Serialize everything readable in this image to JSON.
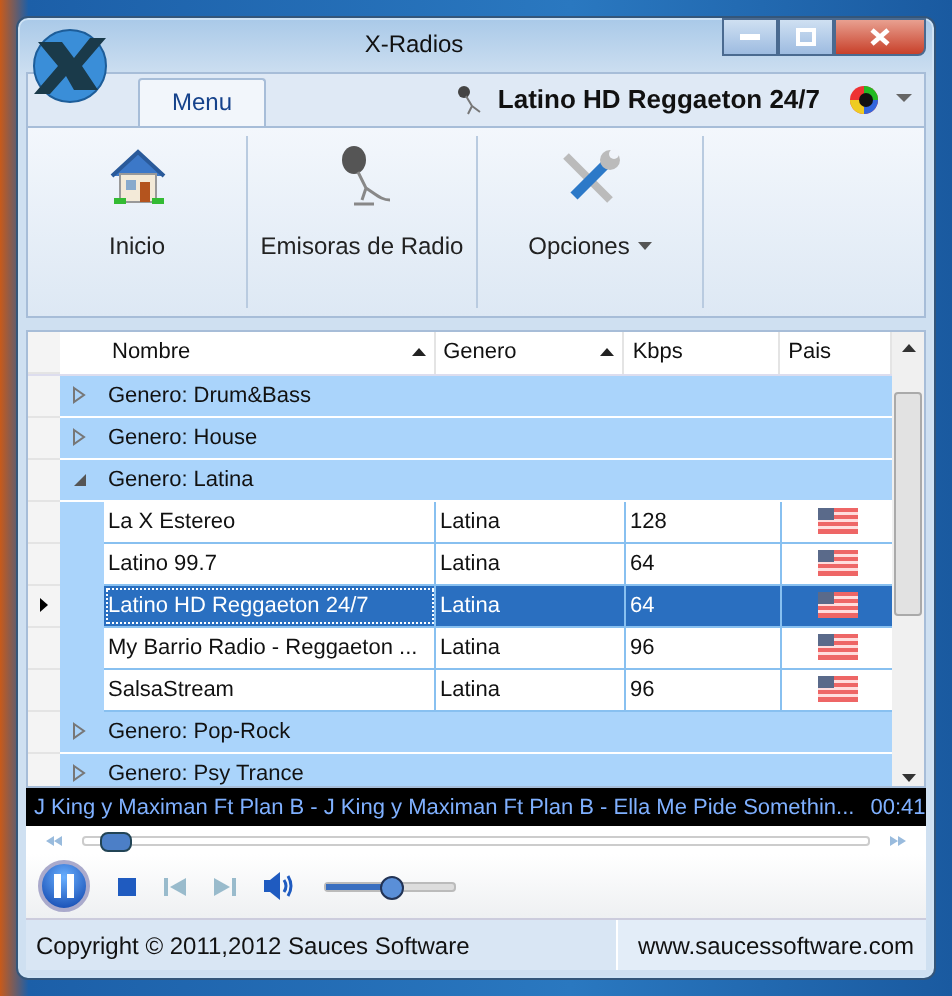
{
  "window": {
    "title": "X-Radios"
  },
  "tabs": [
    {
      "label": "Menu",
      "selected": true
    }
  ],
  "current_station": "Latino HD Reggaeton 24/7",
  "ribbon": [
    {
      "kind": "home",
      "label": "Inicio",
      "dropdown": false
    },
    {
      "kind": "mic",
      "label": "Emisoras de Radio",
      "dropdown": false
    },
    {
      "kind": "tools",
      "label": "Opciones",
      "dropdown": true
    }
  ],
  "table": {
    "columns": [
      {
        "label": "Nombre",
        "sorted": true
      },
      {
        "label": "Genero",
        "sorted": true
      },
      {
        "label": "Kbps",
        "sorted": false
      },
      {
        "label": "Pais",
        "sorted": false
      }
    ],
    "groups": [
      {
        "label": "Genero: Drum&Bass",
        "expanded": false
      },
      {
        "label": "Genero: House",
        "expanded": false
      },
      {
        "label": "Genero: Latina",
        "expanded": true,
        "children": [
          {
            "name": "La X Estereo",
            "genre": "Latina",
            "kbps": "128",
            "selected": false
          },
          {
            "name": "Latino 99.7",
            "genre": "Latina",
            "kbps": "64",
            "selected": false
          },
          {
            "name": "Latino HD Reggaeton 24/7",
            "genre": "Latina",
            "kbps": "64",
            "selected": true
          },
          {
            "name": "My Barrio Radio - Reggaeton ...",
            "genre": "Latina",
            "kbps": "96",
            "selected": false
          },
          {
            "name": "SalsaStream",
            "genre": "Latina",
            "kbps": "96",
            "selected": false
          }
        ]
      },
      {
        "label": "Genero: Pop-Rock",
        "expanded": false
      },
      {
        "label": "Genero: Psy Trance",
        "expanded": false
      }
    ]
  },
  "player": {
    "now_playing": "J King y Maximan Ft Plan B - J King y Maximan Ft Plan B - Ella Me Pide Somethin...",
    "time": "00:41",
    "playing": true,
    "seek": {
      "level": 0.02
    },
    "volume": {
      "level": 0.5
    }
  },
  "status_bar": {
    "copyright": "Copyright ©  2011,2012 Sauces Software",
    "website": "www.saucessoftware.com"
  }
}
